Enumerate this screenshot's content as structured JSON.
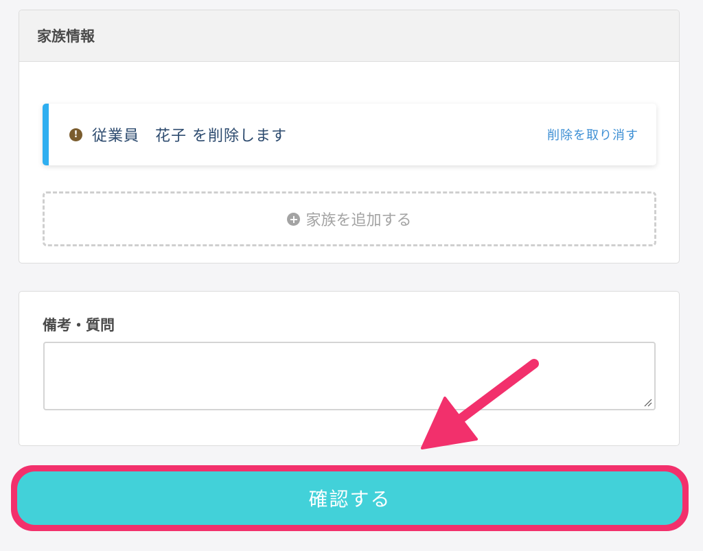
{
  "family_section": {
    "title": "家族情報",
    "notice": {
      "icon": "exclamation-circle-icon",
      "message": "従業員　花子 を削除します",
      "undo_label": "削除を取り消す",
      "accent_color": "#2eaef0"
    },
    "add_family_label": "家族を追加する",
    "add_icon": "plus-circle-icon"
  },
  "notes_section": {
    "label": "備考・質問",
    "value": "",
    "placeholder": ""
  },
  "confirm_button": {
    "label": "確認する",
    "color": "#42d1d9",
    "highlight_color": "#f2306c"
  },
  "annotation": {
    "arrow_color": "#f2306c"
  }
}
